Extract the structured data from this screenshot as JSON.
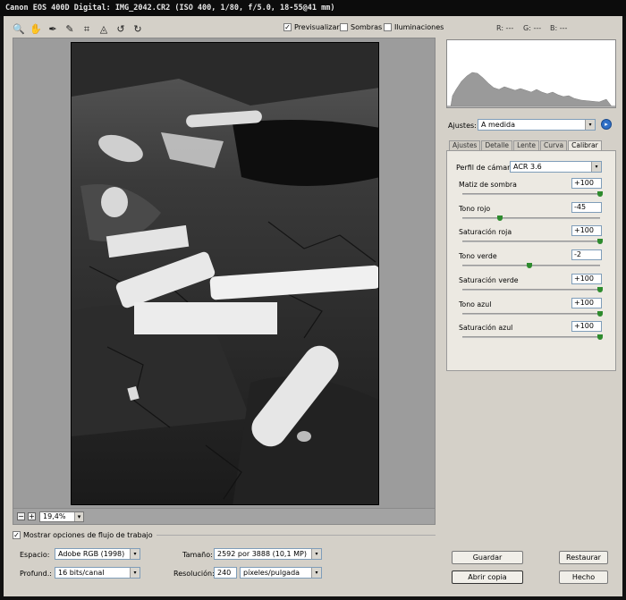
{
  "window": {
    "title": "Canon EOS 400D Digital:  IMG_2042.CR2  (ISO 400, 1/80, f/5.0, 18-55@41 mm)"
  },
  "toolbar": {
    "tools": [
      {
        "name": "zoom-tool-icon",
        "glyph": "🔍"
      },
      {
        "name": "hand-tool-icon",
        "glyph": "✋"
      },
      {
        "name": "white-balance-tool-icon",
        "glyph": "✒"
      },
      {
        "name": "color-sampler-tool-icon",
        "glyph": "✎"
      },
      {
        "name": "crop-tool-icon",
        "glyph": "⌗"
      },
      {
        "name": "straighten-tool-icon",
        "glyph": "◬"
      },
      {
        "name": "rotate-left-icon",
        "glyph": "↺"
      },
      {
        "name": "rotate-right-icon",
        "glyph": "↻"
      }
    ],
    "preview_label": "Previsualizar",
    "preview_checked": "✓",
    "shadows_label": "Sombras",
    "highlights_label": "Iluminaciones",
    "r_readout": "R: ---",
    "g_readout": "G: ---",
    "b_readout": "B: ---"
  },
  "zoom": {
    "minus": "−",
    "plus": "+",
    "value": "19,4%",
    "arrow": "▾"
  },
  "settings": {
    "label": "Ajustes:",
    "value": "A medida",
    "arrow": "▾",
    "go": "▸"
  },
  "tabs": [
    "Ajustes",
    "Detalle",
    "Lente",
    "Curva",
    "Calibrar"
  ],
  "active_tab": "Calibrar",
  "calibrate": {
    "profile_label": "Perfil de cámara:",
    "profile_value": "ACR 3.6",
    "sliders": [
      {
        "label": "Matiz de sombra",
        "value": "+100",
        "level": 1.0
      },
      {
        "label": "Tono rojo",
        "value": "-45",
        "level": 0.275
      },
      {
        "label": "Saturación roja",
        "value": "+100",
        "level": 1.0
      },
      {
        "label": "Tono verde",
        "value": "-2",
        "level": 0.49
      },
      {
        "label": "Saturación verde",
        "value": "+100",
        "level": 1.0
      },
      {
        "label": "Tono azul",
        "value": "+100",
        "level": 1.0
      },
      {
        "label": "Saturación azul",
        "value": "+100",
        "level": 1.0
      }
    ]
  },
  "workflow": {
    "show_label": "Mostrar opciones de flujo de trabajo",
    "show_checked": "✓",
    "space_label": "Espacio:",
    "space_value": "Adobe RGB (1998)",
    "depth_label": "Profund.:",
    "depth_value": "16 bits/canal",
    "size_label": "Tamaño:",
    "size_value": "2592 por 3888  (10,1 MP)",
    "res_label": "Resolución:",
    "res_value": "240",
    "res_unit": "píxeles/pulgada"
  },
  "buttons": {
    "save": "Guardar",
    "open_copy": "Abrir copia",
    "reset": "Restaurar",
    "done": "Hecho"
  },
  "colors": {
    "accent_blue": "#2f6fc6",
    "slider_thumb": "#2e8b2e"
  }
}
